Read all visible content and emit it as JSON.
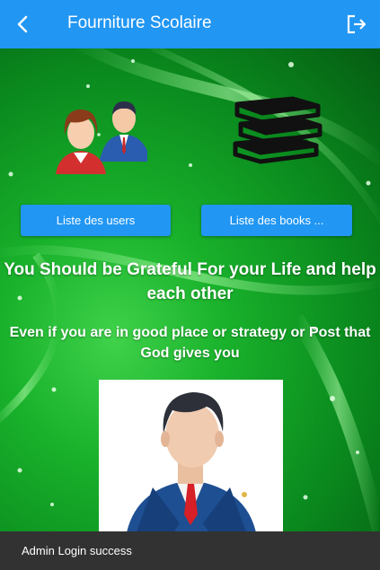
{
  "appbar": {
    "title": "Fourniture Scolaire",
    "back_icon": "arrow-back-icon",
    "logout_icon": "logout-icon",
    "color": "#2196F3"
  },
  "main": {
    "users_button_label": "Liste des users",
    "books_button_label": "Liste des books ...",
    "headline": "You Should be Grateful For your Life and help each other",
    "subline": "Even if you are in good place or strategy or Post that God gives you",
    "users_icon": "users-group-icon",
    "books_icon": "books-stack-icon",
    "admin_icon": "admin-avatar-icon",
    "background_color": "#0a8a1e"
  },
  "snackbar": {
    "message": "Admin Login success"
  }
}
